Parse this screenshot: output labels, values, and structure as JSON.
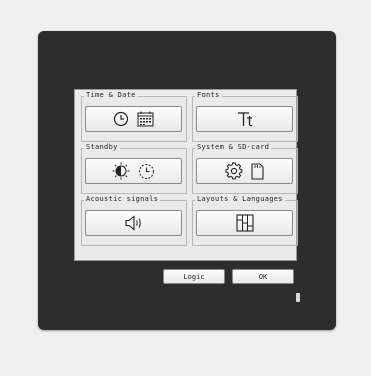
{
  "sections": {
    "time_date": {
      "title": "Time & Date",
      "icons": [
        "clock-icon",
        "calendar-icon"
      ]
    },
    "fonts": {
      "title": "Fonts",
      "icons": [
        "font-icon"
      ]
    },
    "standby": {
      "title": "Standby",
      "icons": [
        "brightness-icon",
        "timer-icon"
      ]
    },
    "system": {
      "title": "System & SD-card",
      "icons": [
        "gear-icon",
        "sd-card-icon"
      ]
    },
    "acoustic": {
      "title": "Acoustic signals",
      "icons": [
        "speaker-icon"
      ]
    },
    "layouts": {
      "title": "Layouts & Languages",
      "icons": [
        "layout-icon"
      ]
    }
  },
  "footer": {
    "logic_label": "Logic",
    "ok_label": "OK"
  },
  "colors": {
    "device": "#2d2d2d",
    "screen": "#eaeaea",
    "background": "#f0f0f0"
  }
}
